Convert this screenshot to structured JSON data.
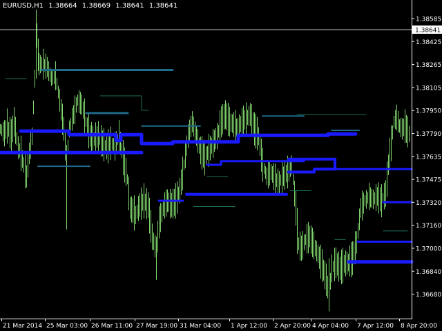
{
  "header": {
    "symbol": "EURUSD,H1",
    "open": "1.38664",
    "high": "1.38669",
    "low": "1.38641",
    "close": "1.38641"
  },
  "colors": {
    "background": "#000000",
    "candles": "#7fd36b",
    "level_blue": "#1a1aff",
    "level_teal": "#1f6b8a",
    "level_green": "#1b6e5a",
    "axis": "#ffffff",
    "price_line": "#c0c0c0"
  },
  "chart_data": {
    "type": "line",
    "current_price_label": "1.38641",
    "y_tick_labels": [
      "1.38585",
      "1.38425",
      "1.38265",
      "1.38105",
      "1.37950",
      "1.37790",
      "1.37635",
      "1.37475",
      "1.37320",
      "1.37160",
      "1.37000",
      "1.36840",
      "1.36680"
    ],
    "x_tick_labels": [
      "21 Mar 2014",
      "25 Mar 03:00",
      "26 Mar 11:00",
      "27 Mar 19:00",
      "31 Mar 04:00",
      "1 Apr 12:00",
      "2 Apr 20:00",
      "4 Apr 04:00",
      "7 Apr 12:00",
      "8 Apr 20:00"
    ],
    "ylim": [
      1.3663,
      1.3878
    ],
    "current_price": 1.38641,
    "price_path": [
      [
        0,
        1.3795
      ],
      [
        6,
        1.3792
      ],
      [
        10,
        1.3797
      ],
      [
        16,
        1.379
      ],
      [
        20,
        1.38
      ],
      [
        26,
        1.3782
      ],
      [
        30,
        1.3778
      ],
      [
        34,
        1.377
      ],
      [
        38,
        1.3762
      ],
      [
        42,
        1.3778
      ],
      [
        46,
        1.379
      ],
      [
        50,
        1.383
      ],
      [
        53,
        1.386
      ],
      [
        56,
        1.384
      ],
      [
        62,
        1.384
      ],
      [
        68,
        1.3838
      ],
      [
        74,
        1.383
      ],
      [
        80,
        1.3832
      ],
      [
        86,
        1.3815
      ],
      [
        92,
        1.3795
      ],
      [
        96,
        1.3772
      ],
      [
        100,
        1.3795
      ],
      [
        106,
        1.3805
      ],
      [
        112,
        1.3815
      ],
      [
        118,
        1.3812
      ],
      [
        124,
        1.38
      ],
      [
        130,
        1.379
      ],
      [
        136,
        1.3788
      ],
      [
        142,
        1.379
      ],
      [
        148,
        1.3785
      ],
      [
        154,
        1.3782
      ],
      [
        160,
        1.3785
      ],
      [
        166,
        1.3783
      ],
      [
        172,
        1.379
      ],
      [
        178,
        1.3775
      ],
      [
        184,
        1.376
      ],
      [
        188,
        1.374
      ],
      [
        192,
        1.3738
      ],
      [
        196,
        1.3735
      ],
      [
        202,
        1.3742
      ],
      [
        208,
        1.3745
      ],
      [
        214,
        1.3742
      ],
      [
        220,
        1.372
      ],
      [
        226,
        1.371
      ],
      [
        230,
        1.373
      ],
      [
        236,
        1.374
      ],
      [
        242,
        1.3745
      ],
      [
        248,
        1.3742
      ],
      [
        254,
        1.3745
      ],
      [
        260,
        1.3752
      ],
      [
        266,
        1.377
      ],
      [
        272,
        1.379
      ],
      [
        278,
        1.38
      ],
      [
        284,
        1.379
      ],
      [
        290,
        1.378
      ],
      [
        296,
        1.3775
      ],
      [
        302,
        1.378
      ],
      [
        308,
        1.3785
      ],
      [
        314,
        1.379
      ],
      [
        320,
        1.38
      ],
      [
        326,
        1.3805
      ],
      [
        332,
        1.38
      ],
      [
        338,
        1.3798
      ],
      [
        344,
        1.3795
      ],
      [
        350,
        1.38
      ],
      [
        356,
        1.3802
      ],
      [
        362,
        1.3805
      ],
      [
        368,
        1.3795
      ],
      [
        374,
        1.379
      ],
      [
        380,
        1.377
      ],
      [
        386,
        1.3762
      ],
      [
        392,
        1.3765
      ],
      [
        398,
        1.376
      ],
      [
        404,
        1.3758
      ],
      [
        410,
        1.3762
      ],
      [
        416,
        1.3765
      ],
      [
        422,
        1.377
      ],
      [
        428,
        1.374
      ],
      [
        432,
        1.3715
      ],
      [
        436,
        1.3712
      ],
      [
        442,
        1.3718
      ],
      [
        448,
        1.372
      ],
      [
        454,
        1.3714
      ],
      [
        460,
        1.3708
      ],
      [
        466,
        1.37
      ],
      [
        472,
        1.369
      ],
      [
        476,
        1.368
      ],
      [
        480,
        1.3698
      ],
      [
        486,
        1.3702
      ],
      [
        492,
        1.3698
      ],
      [
        498,
        1.3701
      ],
      [
        504,
        1.3702
      ],
      [
        510,
        1.3705
      ],
      [
        516,
        1.3716
      ],
      [
        522,
        1.374
      ],
      [
        528,
        1.3745
      ],
      [
        534,
        1.3748
      ],
      [
        540,
        1.3746
      ],
      [
        546,
        1.3748
      ],
      [
        552,
        1.3745
      ],
      [
        558,
        1.375
      ],
      [
        562,
        1.377
      ],
      [
        566,
        1.3785
      ],
      [
        570,
        1.38
      ],
      [
        574,
        1.3803
      ],
      [
        578,
        1.3797
      ],
      [
        582,
        1.3795
      ],
      [
        586,
        1.3797
      ],
      [
        590,
        1.3793
      ],
      [
        594,
        1.379
      ]
    ],
    "levels": [
      {
        "color": "level_blue",
        "w": 5,
        "pts": [
          [
            0,
            1.37785
          ],
          [
            205,
            1.37785
          ]
        ]
      },
      {
        "color": "level_blue",
        "w": 5,
        "pts": [
          [
            30,
            1.37935
          ],
          [
            100,
            1.37935
          ],
          [
            100,
            1.3791
          ],
          [
            168,
            1.3791
          ],
          [
            168,
            1.3787
          ],
          [
            175,
            1.3787
          ],
          [
            175,
            1.3791
          ],
          [
            205,
            1.3791
          ],
          [
            205,
            1.37848
          ],
          [
            250,
            1.37848
          ],
          [
            250,
            1.3786
          ],
          [
            345,
            1.3786
          ],
          [
            345,
            1.37905
          ],
          [
            475,
            1.37905
          ],
          [
            475,
            1.37915
          ],
          [
            515,
            1.37915
          ]
        ]
      },
      {
        "color": "level_blue",
        "w": 4,
        "pts": [
          [
            270,
            1.37495
          ],
          [
            415,
            1.37495
          ]
        ]
      },
      {
        "color": "level_blue",
        "w": 3,
        "pts": [
          [
            230,
            1.3745
          ],
          [
            265,
            1.3745
          ]
        ]
      },
      {
        "color": "level_blue",
        "w": 4,
        "pts": [
          [
            418,
            1.3765
          ],
          [
            455,
            1.3765
          ],
          [
            455,
            1.3767
          ],
          [
            485,
            1.3767
          ],
          [
            485,
            1.3774
          ],
          [
            418,
            1.3774
          ]
        ]
      },
      {
        "color": "level_blue",
        "w": 3,
        "pts": [
          [
            300,
            1.377
          ],
          [
            320,
            1.377
          ],
          [
            320,
            1.37725
          ],
          [
            440,
            1.37725
          ]
        ]
      },
      {
        "color": "level_blue",
        "w": 5,
        "pts": [
          [
            505,
            1.37025
          ],
          [
            596,
            1.37025
          ]
        ]
      },
      {
        "color": "level_blue",
        "w": 3,
        "pts": [
          [
            518,
            1.37165
          ],
          [
            596,
            1.37165
          ]
        ]
      },
      {
        "color": "level_blue",
        "w": 3,
        "pts": [
          [
            555,
            1.3744
          ],
          [
            596,
            1.3744
          ]
        ]
      },
      {
        "color": "level_blue",
        "w": 3,
        "pts": [
          [
            485,
            1.3767
          ],
          [
            596,
            1.3767
          ]
        ]
      },
      {
        "color": "level_teal",
        "w": 3,
        "pts": [
          [
            60,
            1.3836
          ],
          [
            250,
            1.3836
          ]
        ]
      },
      {
        "color": "level_teal",
        "w": 3,
        "pts": [
          [
            125,
            1.3806
          ],
          [
            185,
            1.3806
          ]
        ]
      },
      {
        "color": "level_teal",
        "w": 2,
        "pts": [
          [
            205,
            1.3797
          ],
          [
            290,
            1.3797
          ]
        ]
      },
      {
        "color": "level_teal",
        "w": 2,
        "pts": [
          [
            380,
            1.3804
          ],
          [
            440,
            1.3804
          ]
        ]
      },
      {
        "color": "level_teal",
        "w": 2,
        "pts": [
          [
            480,
            1.3794
          ],
          [
            520,
            1.3794
          ]
        ]
      },
      {
        "color": "level_teal",
        "w": 2,
        "pts": [
          [
            55,
            1.3769
          ],
          [
            130,
            1.3769
          ]
        ]
      },
      {
        "color": "level_green",
        "w": 1,
        "pts": [
          [
            8,
            1.383
          ],
          [
            38,
            1.383
          ]
        ]
      },
      {
        "color": "level_green",
        "w": 1,
        "pts": [
          [
            145,
            1.3818
          ],
          [
            205,
            1.3818
          ],
          [
            205,
            1.3808
          ],
          [
            215,
            1.3808
          ]
        ]
      },
      {
        "color": "level_green",
        "w": 1,
        "pts": [
          [
            430,
            1.3805
          ],
          [
            530,
            1.3805
          ]
        ]
      },
      {
        "color": "level_green",
        "w": 1,
        "pts": [
          [
            300,
            1.3762
          ],
          [
            330,
            1.3762
          ]
        ]
      },
      {
        "color": "level_green",
        "w": 1,
        "pts": [
          [
            280,
            1.3741
          ],
          [
            340,
            1.3741
          ]
        ]
      },
      {
        "color": "level_green",
        "w": 1,
        "pts": [
          [
            420,
            1.3752
          ],
          [
            450,
            1.3752
          ]
        ]
      },
      {
        "color": "level_green",
        "w": 1,
        "pts": [
          [
            485,
            1.3718
          ],
          [
            500,
            1.3718
          ]
        ]
      },
      {
        "color": "level_green",
        "w": 1,
        "pts": [
          [
            555,
            1.3724
          ],
          [
            590,
            1.3724
          ]
        ]
      }
    ]
  }
}
